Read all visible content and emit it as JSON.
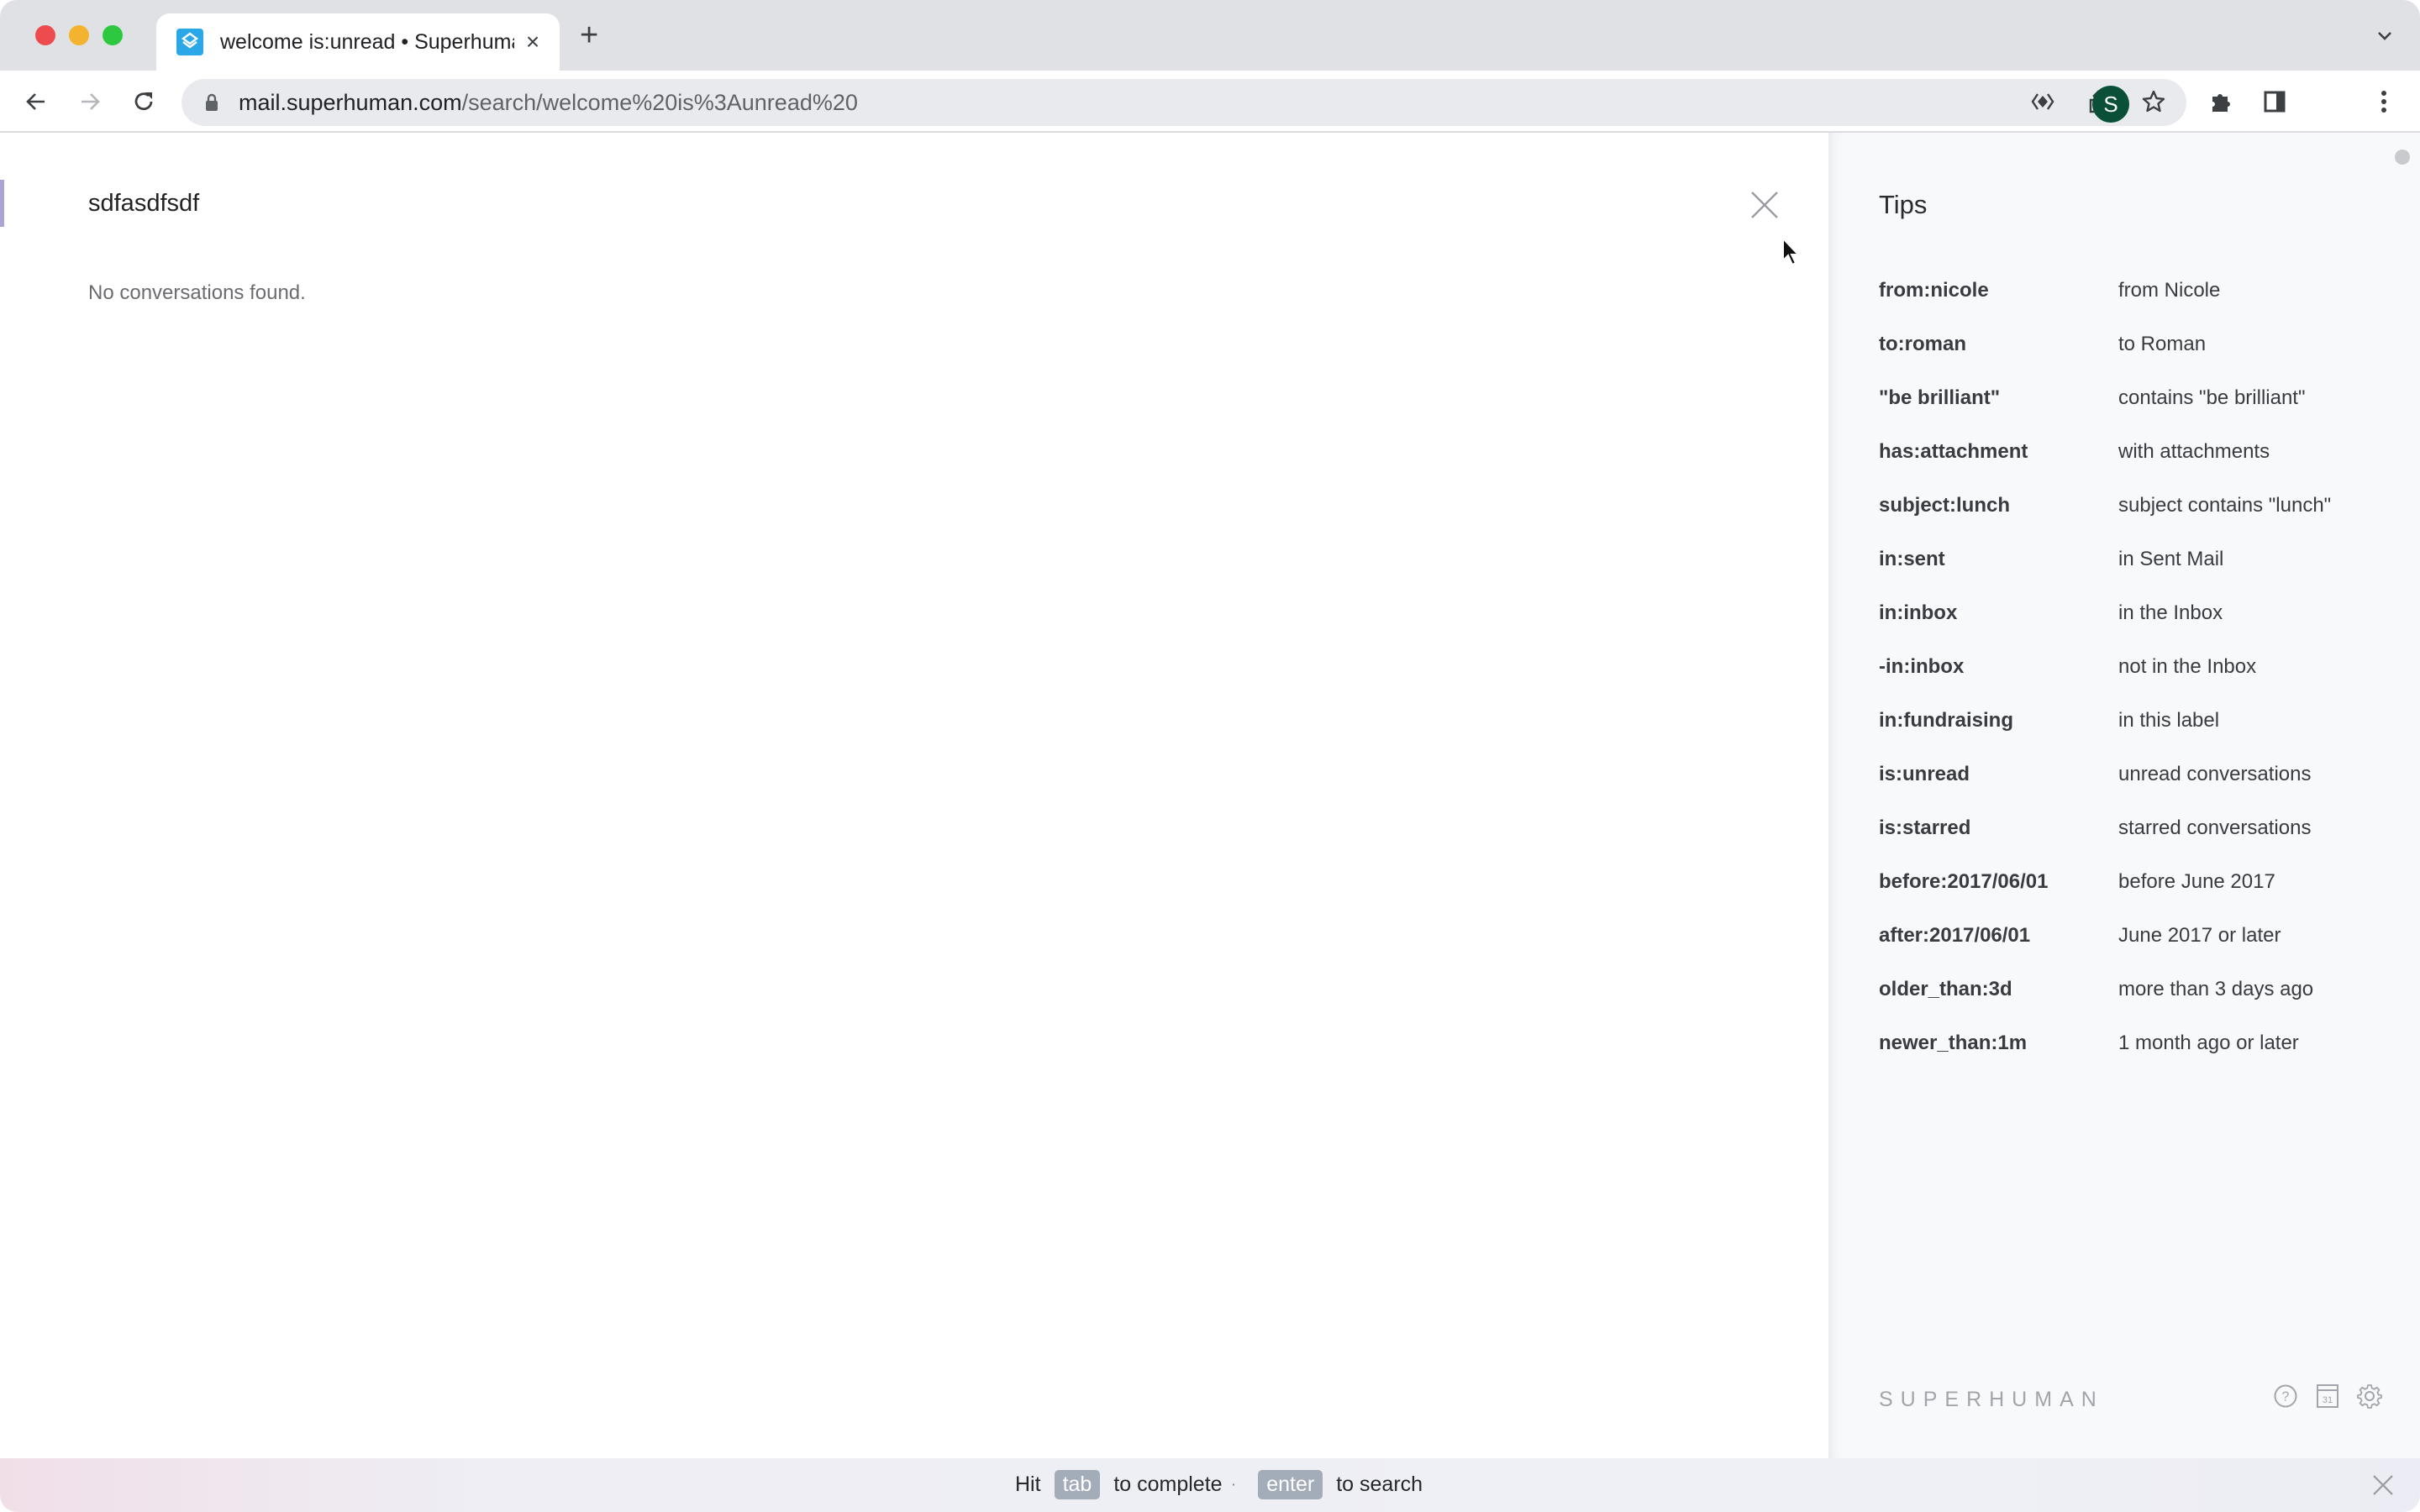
{
  "browser": {
    "tab": {
      "title": "welcome is:unread • Superhuman",
      "favicon": "superhuman-logo-icon"
    },
    "url": {
      "host": "mail.superhuman.com",
      "path": "/search/welcome%20is%3Aunread%20"
    },
    "profile_initial": "S",
    "colors": {
      "profile_avatar": "#0a4f37",
      "favicon": "#2aa7e6"
    }
  },
  "search": {
    "query": "sdfasdfsdf",
    "empty_message": "No conversations found."
  },
  "tips": {
    "title": "Tips",
    "items": [
      {
        "op": "from:nicole",
        "desc": "from Nicole"
      },
      {
        "op": "to:roman",
        "desc": "to Roman"
      },
      {
        "op": "\"be brilliant\"",
        "desc": "contains \"be brilliant\""
      },
      {
        "op": "has:attachment",
        "desc": "with attachments"
      },
      {
        "op": "subject:lunch",
        "desc": "subject contains \"lunch\""
      },
      {
        "op": "in:sent",
        "desc": "in Sent Mail"
      },
      {
        "op": "in:inbox",
        "desc": "in the Inbox"
      },
      {
        "op": "-in:inbox",
        "desc": "not in the Inbox"
      },
      {
        "op": "in:fundraising",
        "desc": "in this label"
      },
      {
        "op": "is:unread",
        "desc": "unread conversations"
      },
      {
        "op": "is:starred",
        "desc": "starred conversations"
      },
      {
        "op": "before:2017/06/01",
        "desc": "before June 2017"
      },
      {
        "op": "after:2017/06/01",
        "desc": "June 2017 or later"
      },
      {
        "op": "older_than:3d",
        "desc": "more than 3 days ago"
      },
      {
        "op": "newer_than:1m",
        "desc": "1 month ago or later"
      }
    ],
    "brand": "SUPERHUMAN",
    "calendar_day": "31"
  },
  "hint": {
    "prefix": "Hit",
    "key1": "tab",
    "action1": "to complete",
    "separator": "·",
    "key2": "enter",
    "action2": "to search"
  }
}
